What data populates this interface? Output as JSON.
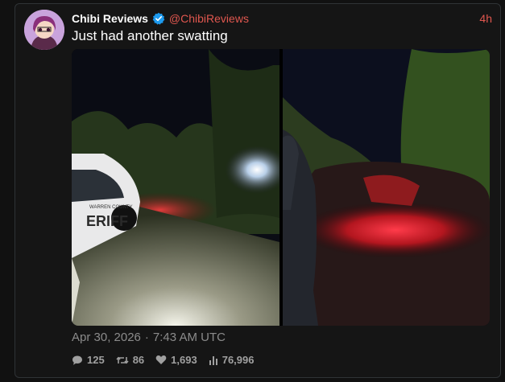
{
  "tweet": {
    "display_name": "Chibi Reviews",
    "handle": "@ChibiReviews",
    "relative_time": "4h",
    "text": "Just had another swatting",
    "date": "Apr 30, 2026",
    "separator": "·",
    "time": "7:43 AM UTC",
    "verified": true,
    "photo_left_text": "ERIFF",
    "photo_left_small_text": "WARREN COUNTY"
  },
  "stats": {
    "replies": "125",
    "reposts": "86",
    "likes": "1,693",
    "views": "76,996"
  },
  "colors": {
    "handle": "#e0574f",
    "verified_badge": "#1d9bf0",
    "background": "#151515",
    "muted_text": "#8b8b8b"
  },
  "icons": {
    "reply": "speech-bubble-icon",
    "repost": "repost-arrows-icon",
    "like": "heart-icon",
    "views": "bar-chart-icon"
  }
}
